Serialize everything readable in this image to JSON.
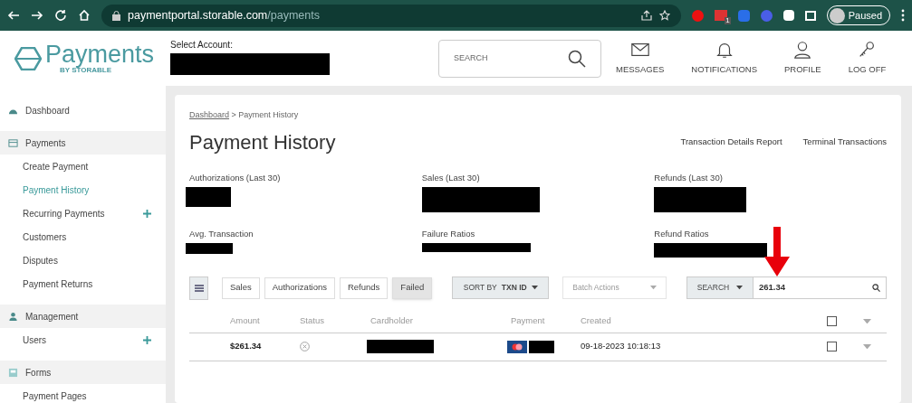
{
  "browser": {
    "url_host": "paymentportal.storable.com",
    "url_path": "/payments",
    "profile_label": "Paused",
    "extension_badge": "1"
  },
  "header": {
    "logo_text": "Payments",
    "logo_sub": "BY STORABLE",
    "account_label": "Select Account:",
    "search_placeholder": "SEARCH",
    "nav": [
      {
        "label": "MESSAGES",
        "kind": "mail"
      },
      {
        "label": "NOTIFICATIONS",
        "kind": "bell"
      },
      {
        "label": "PROFILE",
        "kind": "user"
      },
      {
        "label": "LOG OFF",
        "kind": "key"
      }
    ]
  },
  "sidebar": [
    {
      "kind": "link",
      "label": "Dashboard"
    },
    {
      "kind": "section",
      "label": "Payments",
      "items": [
        {
          "label": "Create Payment",
          "selected": false,
          "expandable": false
        },
        {
          "label": "Payment History",
          "selected": true,
          "expandable": false
        },
        {
          "label": "Recurring Payments",
          "selected": false,
          "expandable": true
        },
        {
          "label": "Customers",
          "selected": false,
          "expandable": false
        },
        {
          "label": "Disputes",
          "selected": false,
          "expandable": false
        },
        {
          "label": "Payment Returns",
          "selected": false,
          "expandable": false
        }
      ]
    },
    {
      "kind": "section",
      "label": "Management",
      "items": [
        {
          "label": "Users",
          "selected": false,
          "expandable": true
        }
      ]
    },
    {
      "kind": "section",
      "label": "Forms",
      "items": [
        {
          "label": "Payment Pages",
          "selected": false,
          "expandable": false
        }
      ]
    }
  ],
  "breadcrumb": {
    "link": "Dashboard",
    "separator": ">",
    "current": "Payment History"
  },
  "title": "Payment History",
  "links": [
    "Transaction Details Report",
    "Terminal Transactions"
  ],
  "stats": [
    {
      "label": "Authorizations (Last 30)"
    },
    {
      "label": "Sales (Last 30)"
    },
    {
      "label": "Refunds (Last 30)"
    },
    {
      "label": "Avg. Transaction"
    },
    {
      "label": "Failure Ratios"
    },
    {
      "label": "Refund Ratios"
    }
  ],
  "filters": [
    {
      "label": "Sales",
      "selected": false
    },
    {
      "label": "Authorizations",
      "selected": false
    },
    {
      "label": "Refunds",
      "selected": false
    },
    {
      "label": "Failed",
      "selected": true
    }
  ],
  "sort": {
    "label": "SORT BY",
    "value": "TXN ID"
  },
  "batch": {
    "label": "Batch Actions",
    "disabled": true
  },
  "search": {
    "label": "SEARCH",
    "value": "261.34"
  },
  "columns": [
    "Amount",
    "Status",
    "Cardholder",
    "Payment",
    "Created"
  ],
  "header_checked": false,
  "rows": [
    {
      "amount": "$261.34",
      "kind": "failed",
      "created": "09-18-2023 10:18:13",
      "checked": false
    }
  ]
}
